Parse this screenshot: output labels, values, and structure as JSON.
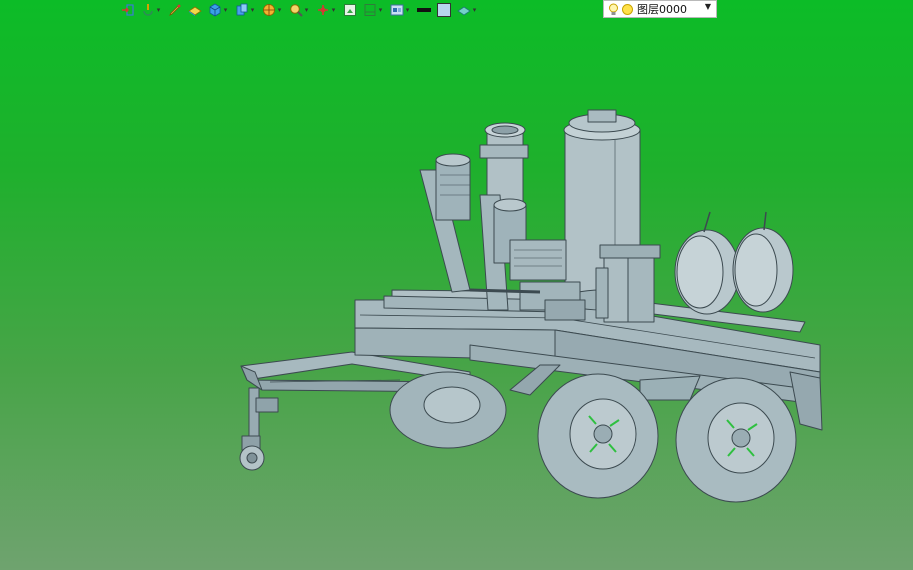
{
  "toolbar": {
    "items": [
      {
        "icon": "insert-component-icon",
        "dropdown": false
      },
      {
        "icon": "rotate-view-icon",
        "dropdown": true
      },
      {
        "icon": "pencil-sketch-icon",
        "dropdown": false
      },
      {
        "icon": "plane-icon",
        "dropdown": false
      },
      {
        "icon": "solid-box-icon",
        "dropdown": true
      },
      {
        "icon": "part-stack-icon",
        "dropdown": true
      },
      {
        "icon": "view-orient-icon",
        "dropdown": true
      },
      {
        "icon": "zoom-icon",
        "dropdown": true
      },
      {
        "icon": "axis-icon",
        "dropdown": true
      },
      {
        "icon": "fit-view-icon",
        "dropdown": false
      },
      {
        "icon": "section-view-icon",
        "dropdown": true
      },
      {
        "icon": "display-mode-icon",
        "dropdown": true
      },
      {
        "icon": "line-color-icon",
        "dropdown": false
      },
      {
        "icon": "fill-color-icon",
        "dropdown": false
      },
      {
        "icon": "render-style-icon",
        "dropdown": true
      }
    ],
    "layer": {
      "label": "图层0000",
      "bulb_icon": "bulb-icon",
      "state_icon": "layer-on-icon"
    }
  },
  "viewport": {
    "background_top": "#0cbc27",
    "background_bottom": "#6fa36f",
    "model_color": "#a7b9bf",
    "model_stroke": "#3c4a50",
    "accent_green": "#2fc040"
  }
}
